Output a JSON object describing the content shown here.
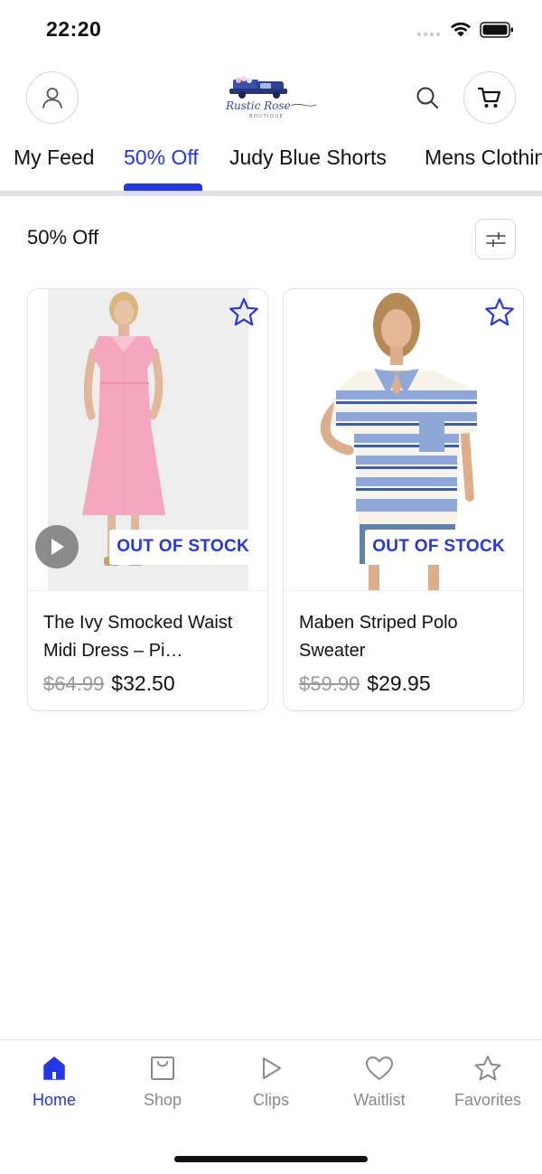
{
  "status_bar": {
    "time": "22:20"
  },
  "header": {
    "logo_alt": "Rustic Rose Boutique"
  },
  "tabs": [
    {
      "label": "My Feed",
      "active": false
    },
    {
      "label": "50% Off",
      "active": true
    },
    {
      "label": "Judy Blue Shorts",
      "active": false
    },
    {
      "label": "Mens Clothing",
      "active": false
    }
  ],
  "section": {
    "title": "50% Off"
  },
  "products": [
    {
      "name": "The Ivy Smocked Waist Midi Dress – Pi…",
      "original_price": "$64.99",
      "sale_price": "$32.50",
      "badge": "OUT OF STOCK",
      "has_video": true
    },
    {
      "name": "Maben Striped Polo Sweater",
      "original_price": "$59.90",
      "sale_price": "$29.95",
      "badge": "OUT OF STOCK",
      "has_video": false
    }
  ],
  "bottom_nav": [
    {
      "label": "Home",
      "icon": "home-icon",
      "active": true
    },
    {
      "label": "Shop",
      "icon": "shopping-bag-icon",
      "active": false
    },
    {
      "label": "Clips",
      "icon": "play-icon",
      "active": false
    },
    {
      "label": "Waitlist",
      "icon": "heart-icon",
      "active": false
    },
    {
      "label": "Favorites",
      "icon": "star-icon",
      "active": false
    }
  ],
  "colors": {
    "accent": "#2535e8",
    "muted": "#8a8a8a",
    "divider": "#dfe1e5"
  }
}
